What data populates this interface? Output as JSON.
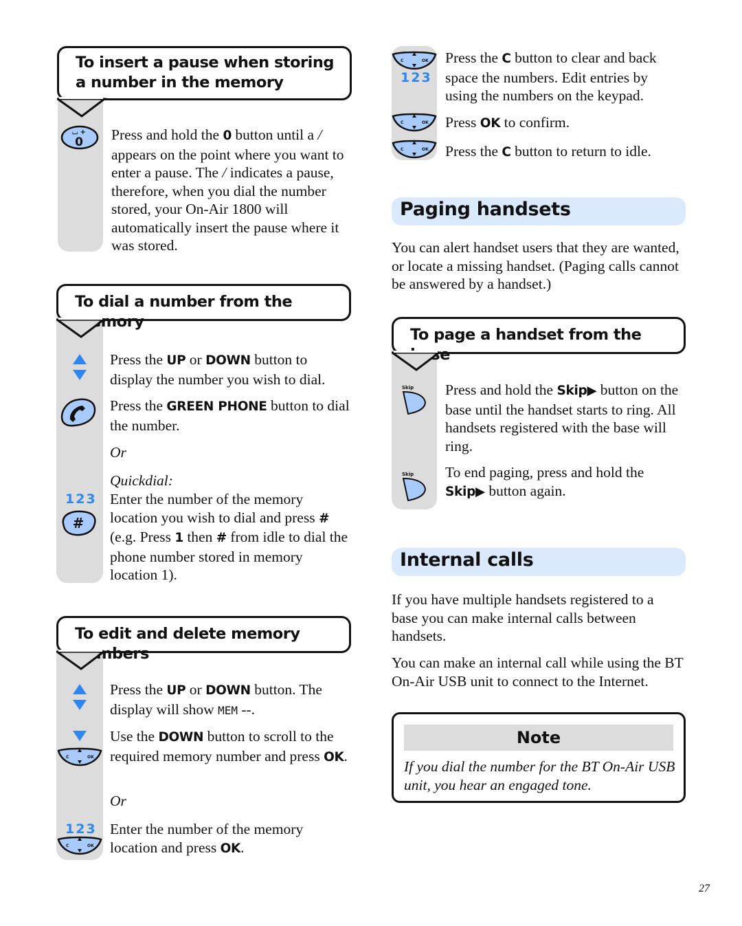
{
  "page_number": "27",
  "left": {
    "pause": {
      "title_line1": "To insert a pause when storing",
      "title_line2": "a number in the memory",
      "key_icon": "zero-key-icon",
      "key_top": "⌴+",
      "key_label": "0",
      "text": {
        "p1": "Press and hold the ",
        "b1": "0",
        "p2": " button until a ",
        "sym1": "/",
        "p3": " appears on the point where you want to enter a pause. The ",
        "sym2": "/",
        "p4": " indicates a pause, therefore, when you dial the number stored, your On-Air 1800 will automatically insert the pause where it was stored."
      }
    },
    "dial": {
      "title": "To dial a number from the memory",
      "step1": {
        "p1": "Press the ",
        "b1": "UP",
        "p2": " or ",
        "b2": "DOWN",
        "p3": " button to display the number you wish to dial."
      },
      "step2": {
        "p1": "Press the ",
        "b1": "GREEN PHONE",
        "p2": " button to dial the number."
      },
      "or": "Or",
      "quickdial_label": "Quickdial:",
      "keypad_label": "123",
      "hash_label": "#",
      "step3": {
        "p1": "Enter the  number of the memory location you wish to dial and press ",
        "b1": "#",
        "p2": " (e.g. Press ",
        "b2": "1",
        "p3": " then ",
        "b3": "#",
        "p4": " from idle to dial the phone number stored in memory location 1)."
      }
    },
    "edit": {
      "title": "To edit and delete memory numbers",
      "step1": {
        "p1": "Press the ",
        "b1": "UP",
        "p2": " or ",
        "b2": "DOWN",
        "p3": " button. The display will show ",
        "lcd": "MEM",
        "p4": " --."
      },
      "step2": {
        "p1": "Use the ",
        "b1": "DOWN",
        "p2": " button to scroll to the required memory number and press ",
        "b2": "OK",
        "p3": "."
      },
      "or": "Or",
      "keypad_label": "123",
      "step3": {
        "p1": "Enter the number of the memory location and press ",
        "b1": "OK",
        "p2": "."
      }
    }
  },
  "right": {
    "edit_cont": {
      "keypad_label": "123",
      "step1": {
        "p1": "Press the ",
        "b1": "C",
        "p2": " button to clear and back space the numbers. Edit entries by using the numbers on the keypad."
      },
      "step2": {
        "p1": "Press ",
        "b1": "OK",
        "p2": " to confirm."
      },
      "step3": {
        "p1": "Press the ",
        "b1": "C",
        "p2": " button to return to idle."
      }
    },
    "paging": {
      "heading": "Paging handsets",
      "intro": "You can alert handset users that they are wanted, or locate a missing handset. (Paging calls cannot be answered by a handset.)",
      "callout_title": "To page a handset from the base",
      "skip_label": "Skip",
      "step1": {
        "p1": "Press and hold the ",
        "b1": "Skip▶",
        "p2": " button on the base until the handset starts to ring. All handsets registered with the base will ring."
      },
      "step2": {
        "p1": "To end paging, press and hold the ",
        "b1": "Skip▶",
        "p2": " button again."
      }
    },
    "internal": {
      "heading": "Internal calls",
      "para1": "If you have multiple handsets registered to a base you can make internal calls between handsets.",
      "para2": "You can make an internal call while using the BT On-Air USB unit to connect to the Internet."
    },
    "note": {
      "title": "Note",
      "text": "If you dial the number for the BT On-Air USB unit, you hear an engaged tone."
    }
  },
  "colors": {
    "icon_fill": "#a9cbfb",
    "accent_blue": "#2f86f0",
    "rail_gray": "#dcdcdc",
    "heading_bg": "#dbe9fc"
  }
}
